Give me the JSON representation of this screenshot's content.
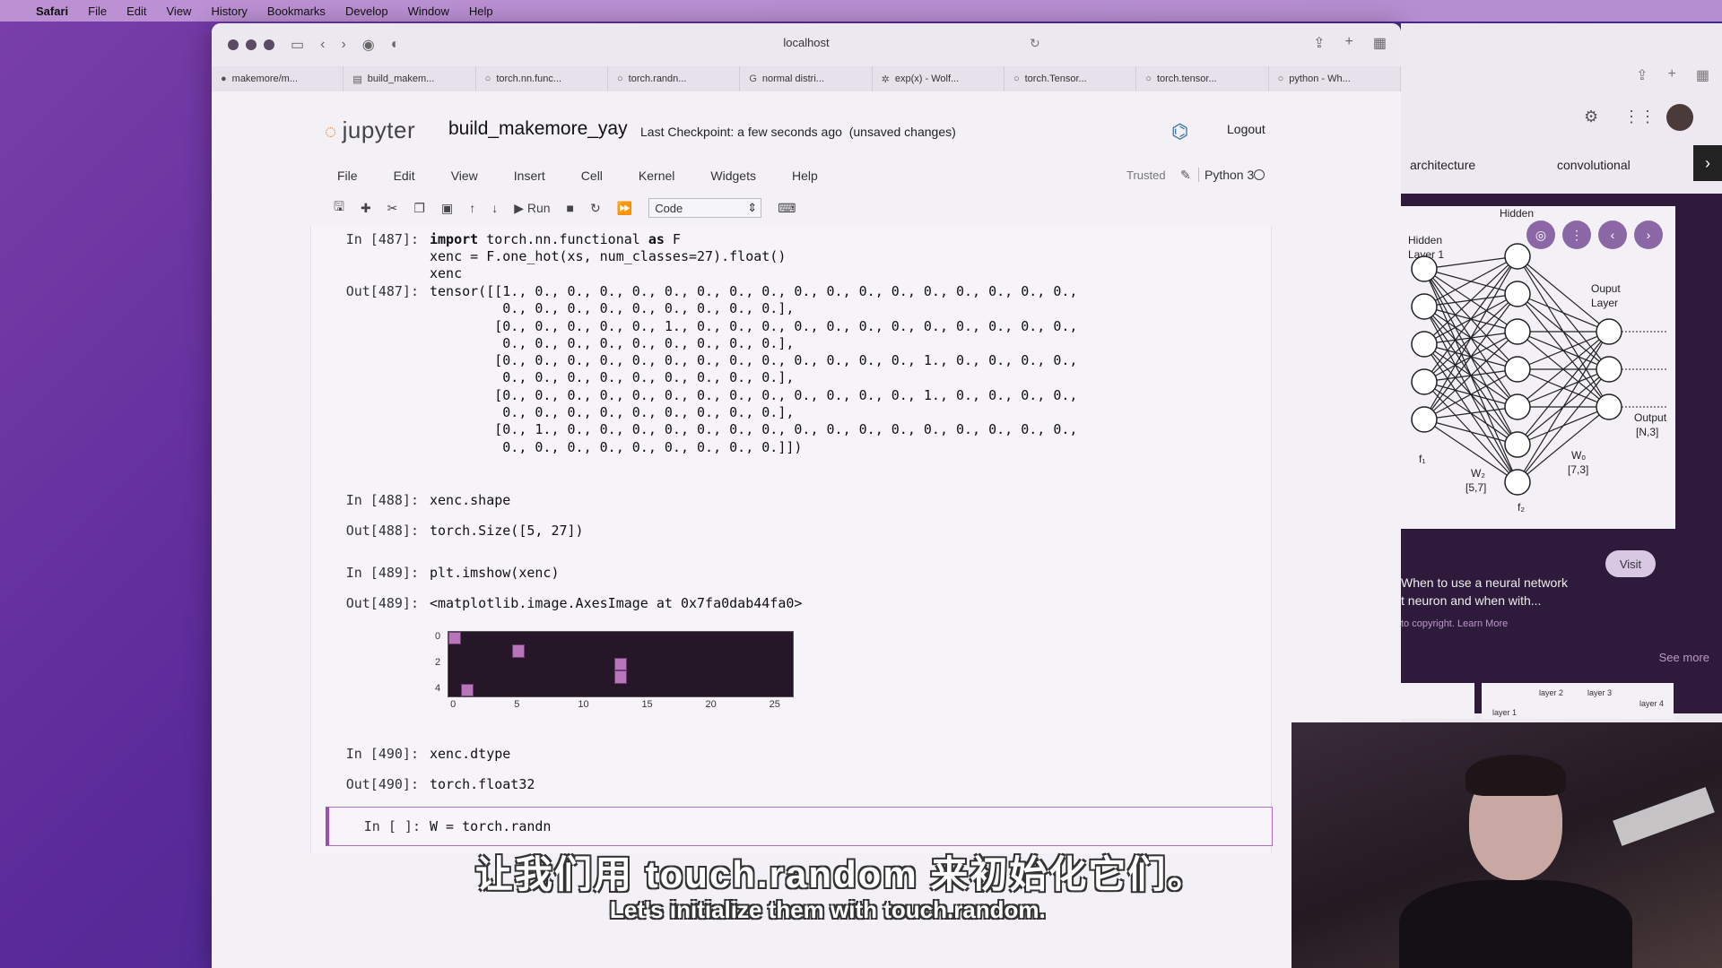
{
  "mac_menubar": {
    "items": [
      "Safari",
      "File",
      "Edit",
      "View",
      "History",
      "Bookmarks",
      "Develop",
      "Window",
      "Help"
    ]
  },
  "browser": {
    "url": "localhost",
    "tabs": [
      {
        "label": "makemore/m...",
        "icon": "github-icon"
      },
      {
        "label": "build_makem...",
        "icon": "notebook-icon"
      },
      {
        "label": "torch.nn.func...",
        "icon": "pytorch-icon"
      },
      {
        "label": "torch.randn...",
        "icon": "pytorch-icon"
      },
      {
        "label": "normal distri...",
        "icon": "google-icon"
      },
      {
        "label": "exp(x) - Wolf...",
        "icon": "wolfram-icon"
      },
      {
        "label": "torch.Tensor...",
        "icon": "pytorch-icon"
      },
      {
        "label": "torch.tensor...",
        "icon": "pytorch-icon"
      },
      {
        "label": "python - Wh...",
        "icon": "pytorch-icon"
      }
    ]
  },
  "jupyter": {
    "logo": "jupyter",
    "notebook_name": "build_makemore_yay",
    "checkpoint": "Last Checkpoint: a few seconds ago",
    "unsaved": "(unsaved changes)",
    "logout": "Logout",
    "menu": [
      "File",
      "Edit",
      "View",
      "Insert",
      "Cell",
      "Kernel",
      "Widgets",
      "Help"
    ],
    "trusted": "Trusted",
    "kernel": "Python 3",
    "toolbar": {
      "run": "Run",
      "cell_type": "Code"
    }
  },
  "cells": [
    {
      "in": "In [487]:",
      "code_kw": "import",
      "code_line1_rest": " torch.nn.functional ",
      "code_kw2": "as",
      "code_line1_end": " F",
      "code_line2": "xenc = F.one_hot(xs, num_classes=27).float()",
      "code_line3": "xenc",
      "out": "Out[487]:",
      "output": "tensor([[1., 0., 0., 0., 0., 0., 0., 0., 0., 0., 0., 0., 0., 0., 0., 0., 0., 0.,\n         0., 0., 0., 0., 0., 0., 0., 0., 0.],\n        [0., 0., 0., 0., 0., 1., 0., 0., 0., 0., 0., 0., 0., 0., 0., 0., 0., 0.,\n         0., 0., 0., 0., 0., 0., 0., 0., 0.],\n        [0., 0., 0., 0., 0., 0., 0., 0., 0., 0., 0., 0., 0., 1., 0., 0., 0., 0.,\n         0., 0., 0., 0., 0., 0., 0., 0., 0.],\n        [0., 0., 0., 0., 0., 0., 0., 0., 0., 0., 0., 0., 0., 1., 0., 0., 0., 0.,\n         0., 0., 0., 0., 0., 0., 0., 0., 0.],\n        [0., 1., 0., 0., 0., 0., 0., 0., 0., 0., 0., 0., 0., 0., 0., 0., 0., 0.,\n         0., 0., 0., 0., 0., 0., 0., 0., 0.]])"
    },
    {
      "in": "In [488]:",
      "code": "xenc.shape",
      "out": "Out[488]:",
      "output": "torch.Size([5, 27])"
    },
    {
      "in": "In [489]:",
      "code": "plt.imshow(xenc)",
      "out": "Out[489]:",
      "output": "<matplotlib.image.AxesImage at 0x7fa0dab44fa0>",
      "plot": {
        "y_ticks": [
          "0",
          "2",
          "4"
        ],
        "x_ticks": [
          "0",
          "5",
          "10",
          "15",
          "20",
          "25"
        ],
        "hot_cells": [
          [
            0,
            0
          ],
          [
            1,
            5
          ],
          [
            2,
            13
          ],
          [
            3,
            13
          ],
          [
            4,
            1
          ]
        ]
      }
    },
    {
      "in": "In [490]:",
      "code": "xenc.dtype",
      "out": "Out[490]:",
      "output": "torch.float32"
    },
    {
      "in": "In [ ]:",
      "code": "W = torch.randn"
    }
  ],
  "subtitles": {
    "chinese": "让我们用 touch.random 来初始化它们。",
    "english": "Let's initialize them with touch.random."
  },
  "side_panel": {
    "chips": [
      "architecture",
      "convolutional"
    ],
    "diagram": {
      "hidden1": "Hidden\nLayer 1",
      "hidden2": "Hidden\nLayer",
      "output_layer": "Ouput\nLayer",
      "output": "Output\n[N,3]",
      "w2": "W₂\n[5,7]",
      "wo": "Wₒ\n[7,3]",
      "f1": "f₁",
      "f2": "f₂"
    },
    "visit": "Visit",
    "caption_line1": "When to use a neural network",
    "caption_line2": "t neuron and when with...",
    "small": "to copyright. Learn More",
    "see_more": "See more",
    "thumb1": "layer 1",
    "thumb2": "layer 2",
    "thumb3": "layer 3",
    "thumb4": "layer 4"
  }
}
